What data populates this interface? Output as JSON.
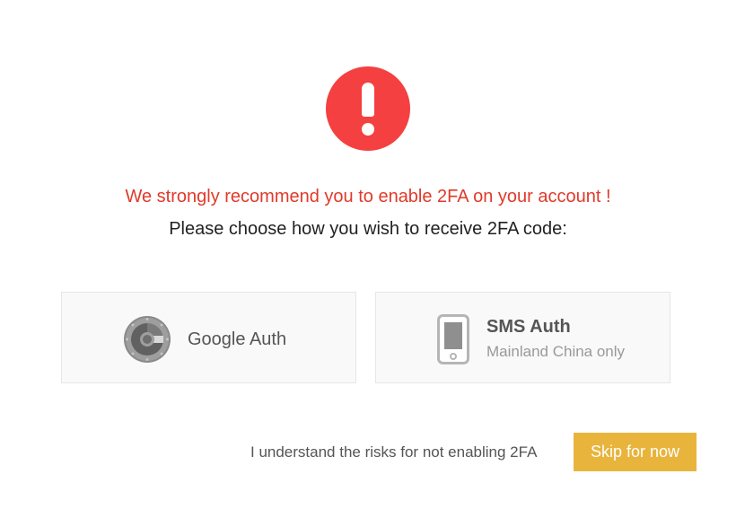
{
  "alert": {
    "icon": "exclamation-icon",
    "color": "#f44040"
  },
  "headline": "We strongly recommend you to enable 2FA on your account !",
  "subline": "Please choose how you wish to receive 2FA code:",
  "options": {
    "google": {
      "icon": "google-authenticator-icon",
      "label": "Google Auth"
    },
    "sms": {
      "icon": "mobile-phone-icon",
      "label": "SMS Auth",
      "sublabel": "Mainland China only"
    }
  },
  "footer": {
    "risk_text": "I understand the risks for not enabling 2FA",
    "skip_label": "Skip for now"
  },
  "colors": {
    "headline": "#e03a2a",
    "button": "#e8b43c"
  }
}
